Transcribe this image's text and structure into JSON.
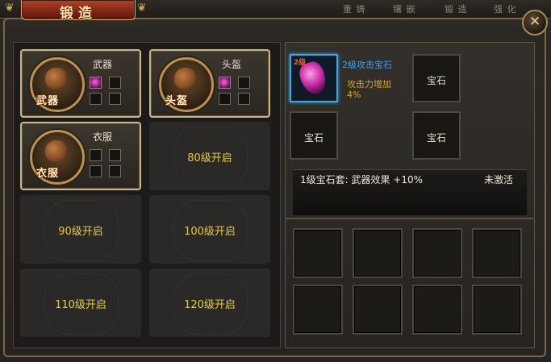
{
  "window": {
    "title": "锻造",
    "close_glyph": "✕",
    "background_tabs": [
      "重 铸",
      "镶 嵌",
      "锻 造",
      "强 化"
    ]
  },
  "equipment_slots": [
    {
      "badge": "武器",
      "name": "武器",
      "gems_filled": [
        true,
        false,
        false,
        false
      ]
    },
    {
      "badge": "头盔",
      "name": "头盔",
      "gems_filled": [
        true,
        false,
        false,
        false
      ]
    },
    {
      "badge": "衣服",
      "name": "衣服",
      "gems_filled": [
        false,
        false,
        false,
        false
      ]
    }
  ],
  "locked_slots": [
    "80级开启",
    "90级开启",
    "100级开启",
    "110级开启",
    "120级开启"
  ],
  "gem_sockets": {
    "selected": {
      "level_tag": "2级",
      "name": "2级攻击宝石",
      "description": "攻击力增加4%"
    },
    "empty_label": "宝石"
  },
  "gem_set": {
    "text": "1级宝石套:  武器效果  +10%",
    "status": "未激活"
  },
  "inventory": {
    "slot_count": 8
  },
  "colors": {
    "gem_name": "#3fa3ff",
    "gem_desc": "#d9a331",
    "locked_text": "#e6c94a",
    "selected_border": "#3da4e6"
  }
}
